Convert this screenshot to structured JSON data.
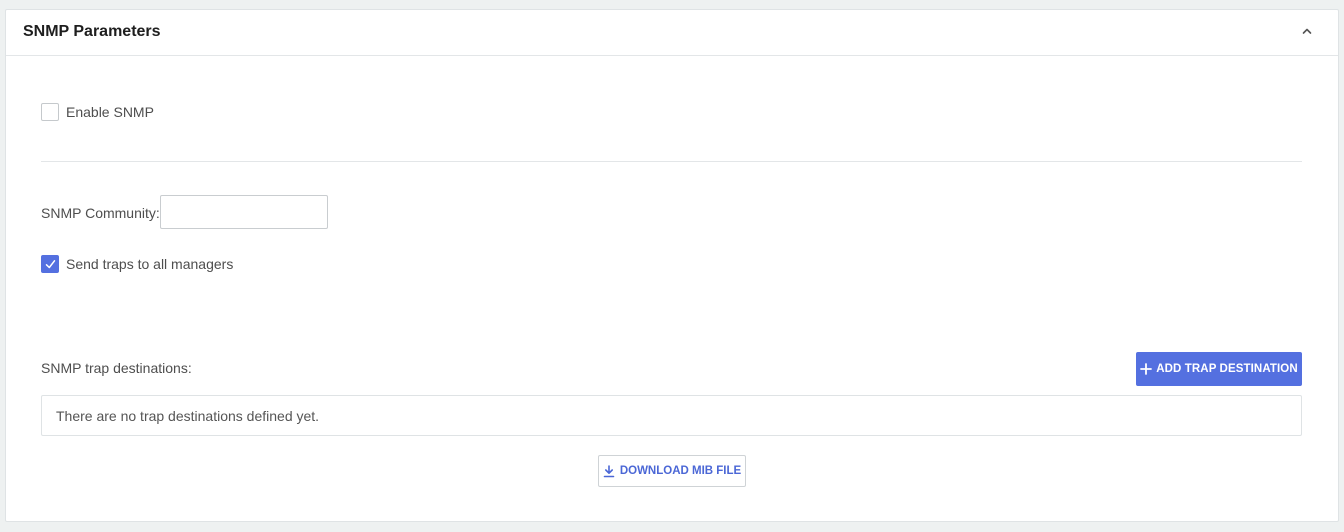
{
  "panel": {
    "title": "SNMP Parameters",
    "collapse_icon": "chevron-up-icon"
  },
  "enable_snmp": {
    "label": "Enable SNMP",
    "checked": false
  },
  "community": {
    "label": "SNMP Community:",
    "value": "",
    "placeholder": ""
  },
  "send_traps": {
    "label": "Send traps to all managers",
    "checked": true
  },
  "trap_destinations": {
    "label": "SNMP trap destinations:",
    "add_button_label": "ADD TRAP DESTINATION",
    "add_icon": "plus-icon",
    "empty_message": "There are no trap destinations defined yet."
  },
  "download": {
    "label": "DOWNLOAD MIB FILE",
    "icon": "download-icon"
  },
  "colors": {
    "accent": "#5470e0",
    "link": "#4b67d6",
    "border": "#dfe3e5"
  }
}
